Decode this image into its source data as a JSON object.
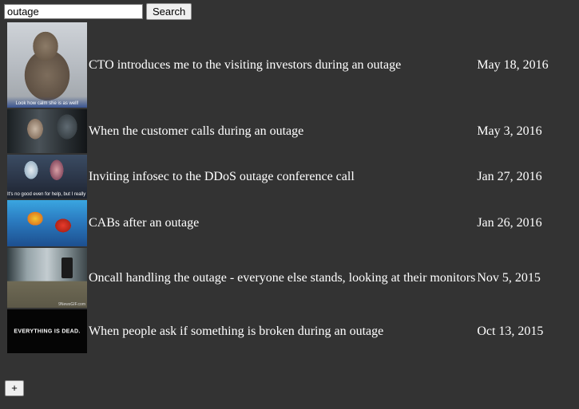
{
  "search": {
    "value": "outage",
    "button_label": "Search"
  },
  "results": [
    {
      "title": "CTO introduces me to the visiting investors during an outage",
      "date": "May 18, 2016",
      "thumb_caption": "Look how calm she is as well!"
    },
    {
      "title": "When the customer calls during an outage",
      "date": "May 3, 2016"
    },
    {
      "title": "Inviting infosec to the DDoS outage conference call",
      "date": "Jan 27, 2016",
      "thumb_caption": "It's no good even for help, but I really don't wanna do this."
    },
    {
      "title": "CABs after an outage",
      "date": "Jan 26, 2016"
    },
    {
      "title": "Oncall handling the outage - everyone else stands, looking at their monitors",
      "date": "Nov 5, 2015",
      "thumb_caption": "9NewsGIF.com"
    },
    {
      "title": "When people ask if something is broken during an outage",
      "date": "Oct 13, 2015",
      "thumb_caption": "EVERYTHING IS DEAD."
    }
  ],
  "add_button_label": "+"
}
